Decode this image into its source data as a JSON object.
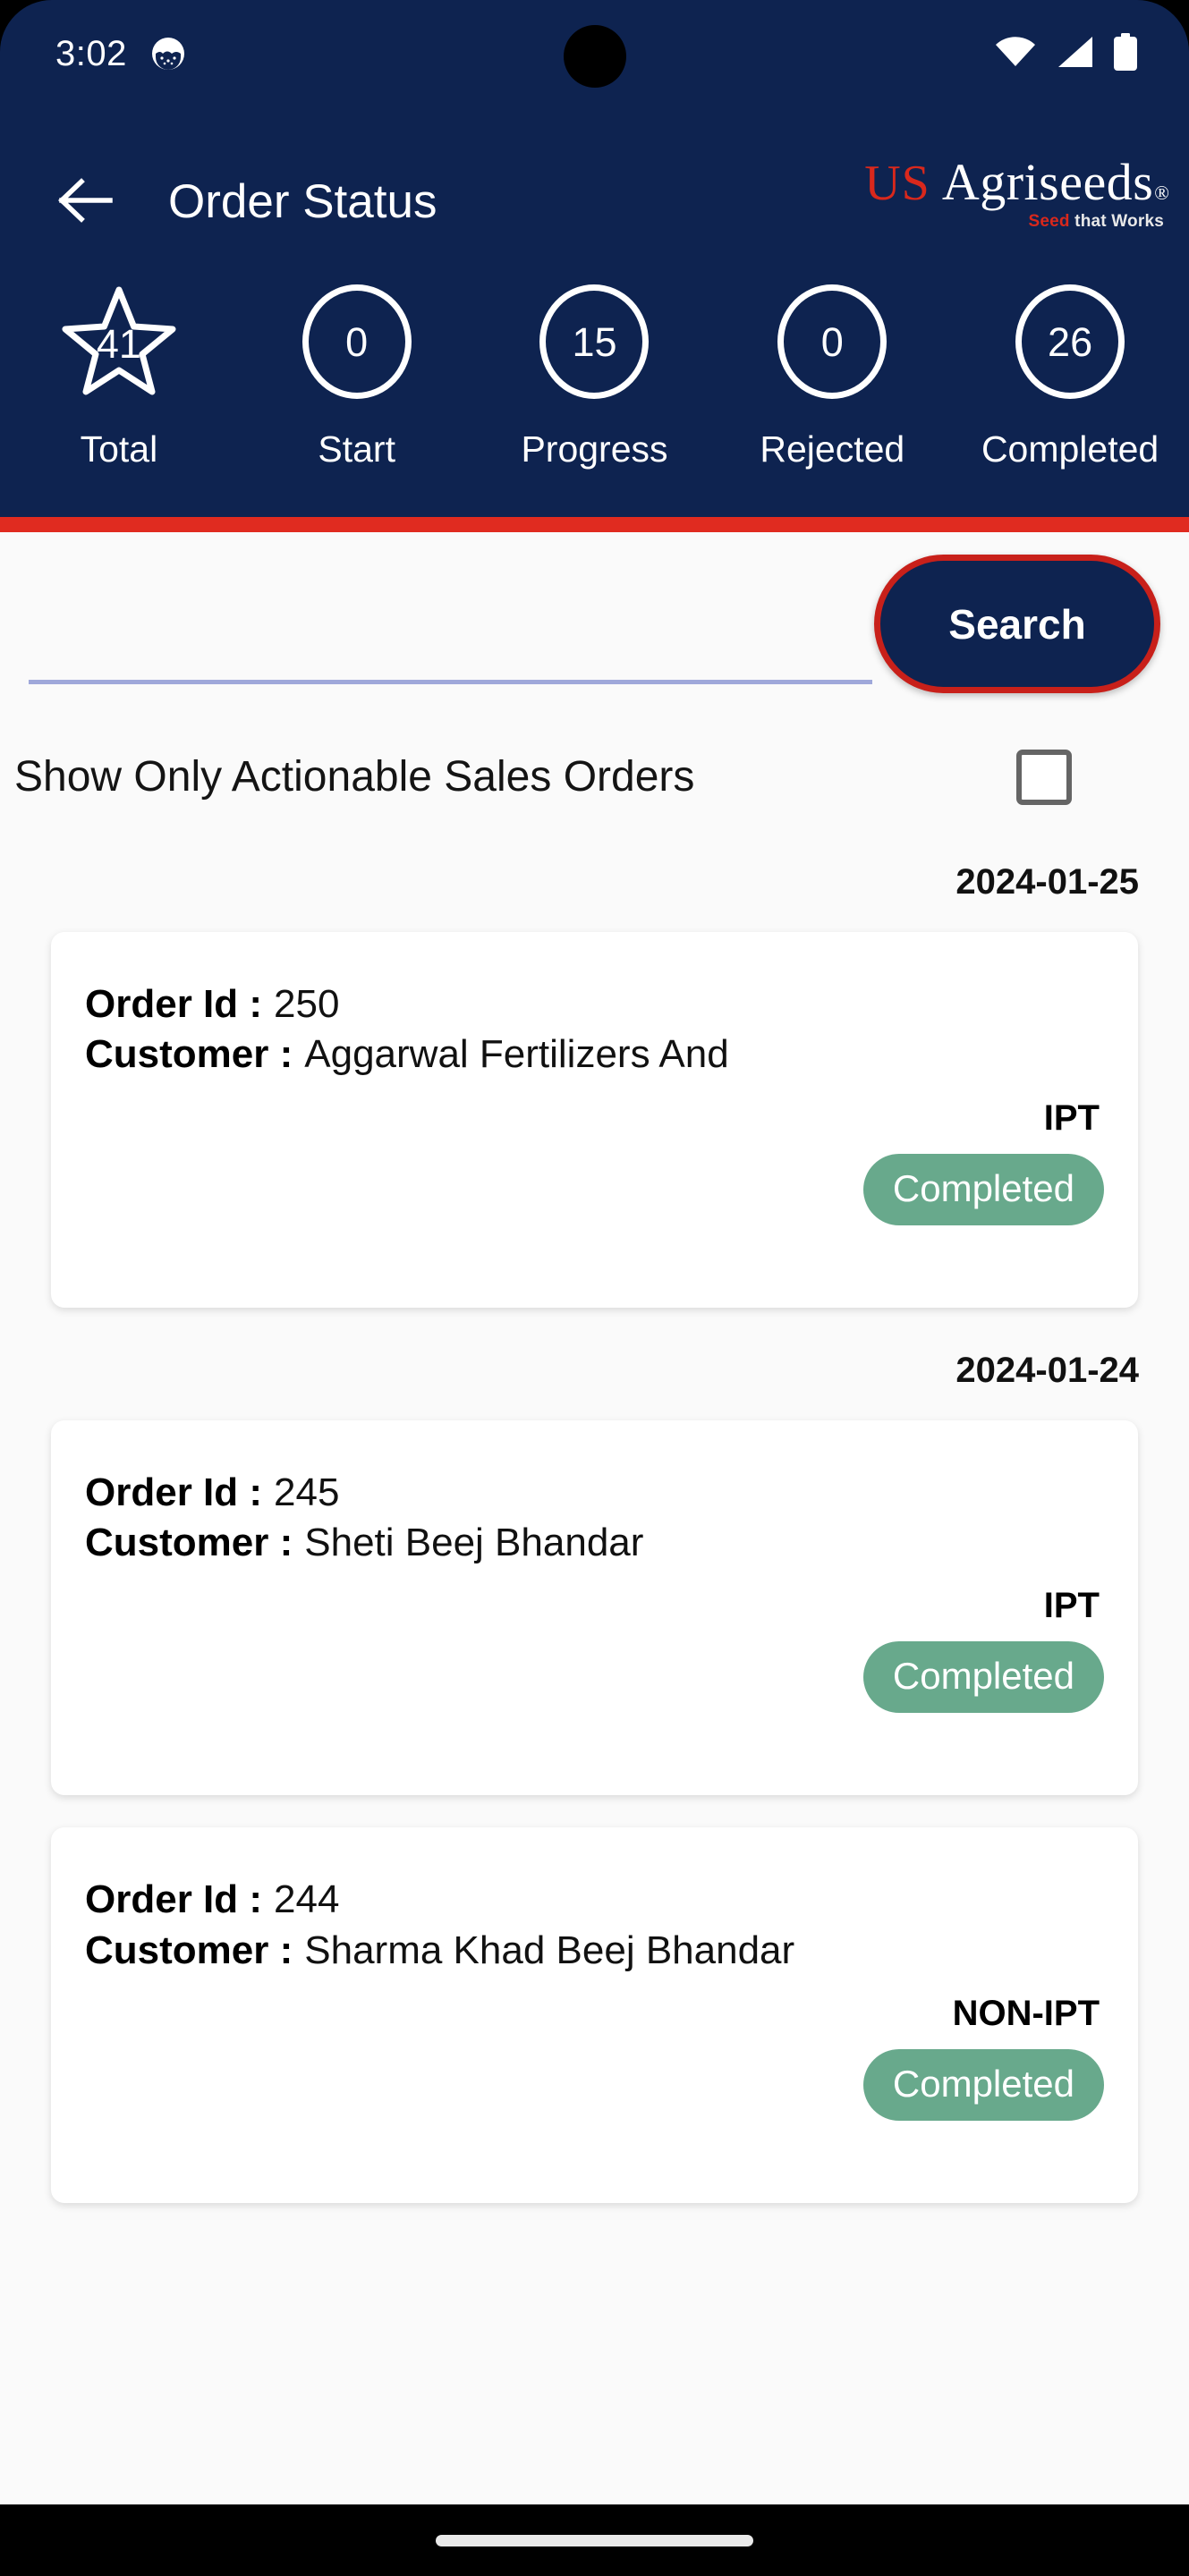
{
  "status_bar": {
    "time": "3:02",
    "icons": [
      "notification-icon",
      "wifi-icon",
      "cellular-signal-icon",
      "battery-icon"
    ]
  },
  "app_bar": {
    "back_icon": "back-arrow-icon",
    "title": "Order Status",
    "logo": {
      "prefix": "US",
      "name": "Agriseeds",
      "registered": "®",
      "tagline_lead": "Seed",
      "tagline_rest": " that Works",
      "tagline_full": "Seed that Works"
    }
  },
  "stats": [
    {
      "value": "41",
      "label": "Total",
      "shape": "star"
    },
    {
      "value": "0",
      "label": "Start",
      "shape": "circle"
    },
    {
      "value": "15",
      "label": "Progress",
      "shape": "circle"
    },
    {
      "value": "0",
      "label": "Rejected",
      "shape": "circle"
    },
    {
      "value": "26",
      "label": "Completed",
      "shape": "circle"
    }
  ],
  "search": {
    "value": "",
    "placeholder": "",
    "button_label": "Search"
  },
  "filter": {
    "label": "Show Only Actionable Sales Orders",
    "checked": false
  },
  "groups": [
    {
      "date": "2024-01-25",
      "orders": [
        {
          "order_id_label": "Order Id :",
          "order_id": "250",
          "customer_label": "Customer :",
          "customer": "Aggarwal Fertilizers And",
          "type": "IPT",
          "status": "Completed"
        }
      ]
    },
    {
      "date": "2024-01-24",
      "orders": [
        {
          "order_id_label": "Order Id :",
          "order_id": "245",
          "customer_label": "Customer :",
          "customer": "Sheti Beej Bhandar",
          "type": "IPT",
          "status": "Completed"
        },
        {
          "order_id_label": "Order Id :",
          "order_id": "244",
          "customer_label": "Customer :",
          "customer": "Sharma Khad Beej Bhandar",
          "type": "NON-IPT",
          "status": "Completed"
        }
      ]
    }
  ],
  "colors": {
    "header_navy": "#0E2350",
    "accent_red": "#E02B20",
    "button_border_red": "#C8201A",
    "brand_red": "#D9281C",
    "status_green": "#68A98C",
    "body_bg": "#FAFAFA",
    "underline": "#9FA8DA"
  }
}
